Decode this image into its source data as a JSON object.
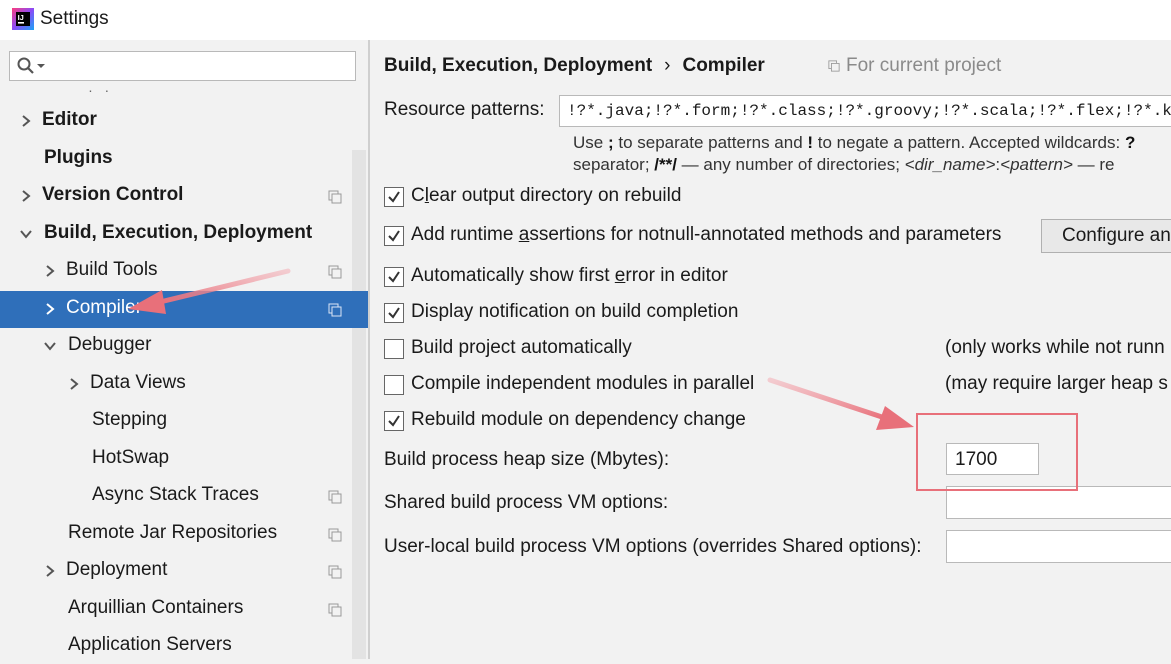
{
  "window": {
    "title": "Settings",
    "logo": "intellij-logo-icon"
  },
  "sidebar": {
    "search": {
      "value": "",
      "placeholder": "",
      "icon": "search-icon"
    },
    "items": [
      {
        "label": "Editor",
        "bold": true,
        "expanded": false
      },
      {
        "label": "Plugins",
        "bold": true
      },
      {
        "label": "Version Control",
        "bold": true,
        "expanded": false,
        "project_icon": true
      },
      {
        "label": "Build, Execution, Deployment",
        "bold": true,
        "expanded": true
      },
      {
        "label": "Build Tools",
        "expanded": false,
        "project_icon": true
      },
      {
        "label": "Compiler",
        "expanded": false,
        "project_icon": true,
        "selected": true
      },
      {
        "label": "Debugger",
        "expanded": true
      },
      {
        "label": "Data Views",
        "expanded": false
      },
      {
        "label": "Stepping"
      },
      {
        "label": "HotSwap"
      },
      {
        "label": "Async Stack Traces",
        "project_icon": true
      },
      {
        "label": "Remote Jar Repositories",
        "project_icon": true
      },
      {
        "label": "Deployment",
        "expanded": false,
        "project_icon": true
      },
      {
        "label": "Arquillian Containers",
        "project_icon": true
      },
      {
        "label": "Application Servers"
      }
    ]
  },
  "main": {
    "breadcrumb": {
      "parent": "Build, Execution, Deployment",
      "separator": "›",
      "current": "Compiler"
    },
    "scope": "For current project",
    "resource_patterns": {
      "label": "Resource patterns:",
      "value": "!?*.java;!?*.form;!?*.class;!?*.groovy;!?*.scala;!?*.flex;!?*.kt;!?*.clj;!?*.aj",
      "hint_line1": {
        "a": "Use ",
        "b": ";",
        "c": " to separate patterns and ",
        "d": "!",
        "e": " to negate a pattern. Accepted wildcards: ",
        "f": "?"
      },
      "hint_line2": {
        "a": "separator; ",
        "b": "/**/",
        "c": " — any number of directories;  ",
        "d": "<dir_name>",
        "e": ":",
        "f": "<pattern>",
        "g": " — re"
      }
    },
    "options": [
      {
        "label_pre": "C",
        "label_u": "l",
        "label_post": "ear output directory on rebuild",
        "checked": true
      },
      {
        "label_pre": "Add runtime ",
        "label_u": "a",
        "label_post": "ssertions for notnull-annotated methods and parameters",
        "checked": true
      },
      {
        "label_pre": "Automatically show first ",
        "label_u": "e",
        "label_post": "rror in editor",
        "checked": true
      },
      {
        "label_pre": "Display notification on build completion",
        "label_u": "",
        "label_post": "",
        "checked": true
      },
      {
        "label_pre": "Build project automatically",
        "label_u": "",
        "label_post": "",
        "checked": false,
        "note": "(only works while not runn"
      },
      {
        "label_pre": "Compile independent modules in parallel",
        "label_u": "",
        "label_post": "",
        "checked": false,
        "note": "(may require larger heap s"
      },
      {
        "label_pre": "Rebuild module on dependency change",
        "label_u": "",
        "label_post": "",
        "checked": true
      }
    ],
    "configure_button": "Configure an",
    "heap": {
      "label": "Build process heap size (Mbytes):",
      "value": "1700"
    },
    "shared_vm": {
      "label": "Shared build process VM options:",
      "value": ""
    },
    "user_vm": {
      "label": "User-local build process VM options (overrides Shared options):",
      "value": ""
    }
  },
  "colors": {
    "selection": "#2f6fba",
    "annotation": "#e8707a"
  }
}
